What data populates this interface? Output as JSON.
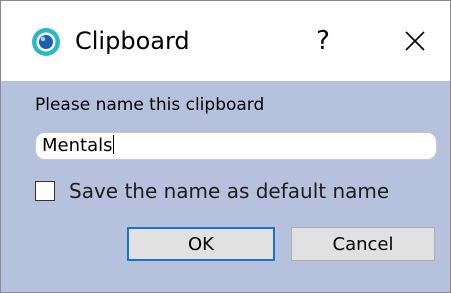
{
  "window": {
    "title": "Clipboard",
    "help_label": "?",
    "icon": "clipboard-app-icon"
  },
  "dialog": {
    "prompt": "Please name this clipboard",
    "name_input": {
      "value": "Mentals"
    },
    "default_checkbox": {
      "label": "Save the name as default name",
      "checked": false
    },
    "ok_label": "OK",
    "cancel_label": "Cancel"
  },
  "colors": {
    "dialog_background": "#b6c1dd",
    "titlebar_background": "#ffffff",
    "ok_focus_border": "#1a73d1",
    "button_background": "#e1e1e1",
    "icon_outer": "#2bb7c9",
    "icon_inner": "#1b5fae"
  }
}
